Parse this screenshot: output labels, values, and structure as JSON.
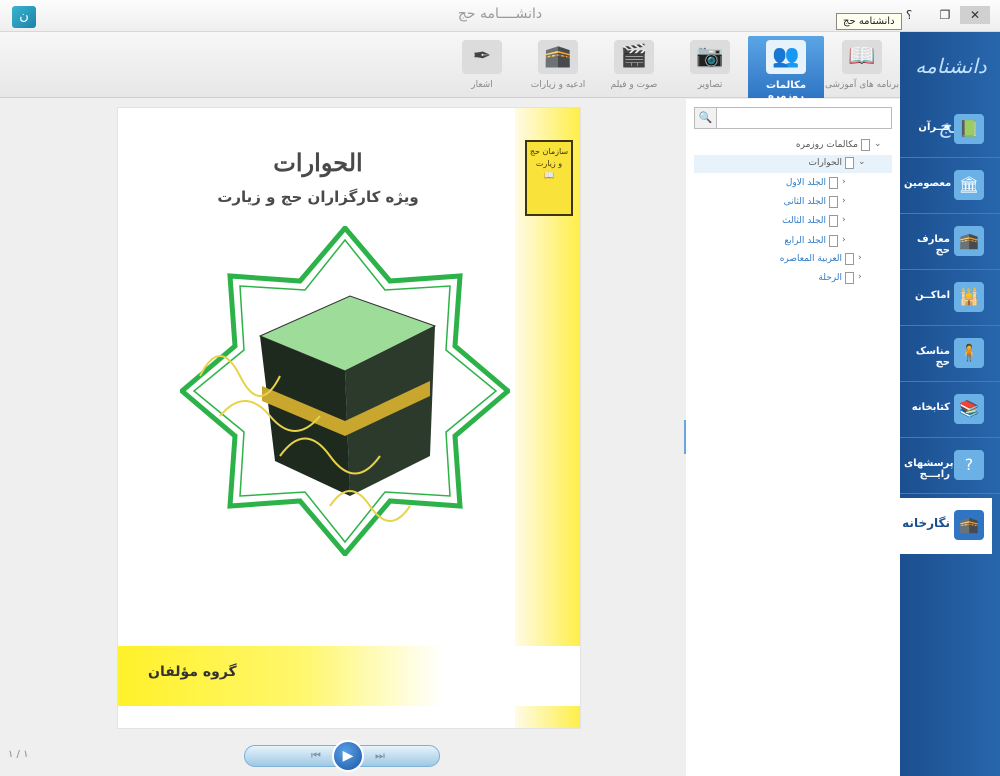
{
  "window": {
    "title": "دانشــــامه حج",
    "tooltip": "دانشنامه حج",
    "help_label": "؟",
    "restore_label": "❐",
    "minimize_label": "—",
    "close_label": "✕",
    "app_icon_label": "ن"
  },
  "toolbar": {
    "tabs": [
      {
        "label": "برنامه های آموزشی",
        "icon": "book-icon"
      },
      {
        "label": "مکالمات روزمره",
        "icon": "people-icon"
      },
      {
        "label": "تصاویر",
        "icon": "camera-icon"
      },
      {
        "label": "صوت و فیلم",
        "icon": "film-icon"
      },
      {
        "label": "ادعیه و زیارات",
        "icon": "prayer-icon"
      },
      {
        "label": "اشعار",
        "icon": "quill-icon"
      }
    ],
    "active_tab": "مکالمات روزمره"
  },
  "sidebar": {
    "logo_text": "دانشنامه حج",
    "items": [
      {
        "label": "قــرآن",
        "icon": "quran-icon"
      },
      {
        "label": "معصومین",
        "icon": "shrine-icon"
      },
      {
        "label": "معارف حج",
        "icon": "kaaba-book-icon"
      },
      {
        "label": "اماکــن",
        "icon": "mosque-icon"
      },
      {
        "label": "مناسک حج",
        "icon": "pilgrim-icon"
      },
      {
        "label": "کتابخانه",
        "icon": "library-icon"
      },
      {
        "label": "پرسشهای رایـــج",
        "icon": "question-icon"
      },
      {
        "label": "نگارخانه",
        "icon": "gallery-icon"
      }
    ],
    "active_item": "نگارخانه"
  },
  "search": {
    "placeholder": "",
    "value": ""
  },
  "tree": [
    {
      "label": "مکالمات روزمره",
      "level": 0,
      "expanded": true
    },
    {
      "label": "الحوارات",
      "level": 1,
      "expanded": true,
      "selected": true
    },
    {
      "label": "الجلد الاول",
      "level": 2
    },
    {
      "label": "الجلد الثانی",
      "level": 2
    },
    {
      "label": "الجلد الثالث",
      "level": 2
    },
    {
      "label": "الجلد الرابع",
      "level": 2
    },
    {
      "label": "العربية المعاصره",
      "level": 1
    },
    {
      "label": "الرحلة",
      "level": 1
    }
  ],
  "viewer": {
    "book_title": "الحوارات",
    "book_subtitle": "ویژه کارگزاران حج و زیارت",
    "authors": "گروه مؤلفان",
    "emblem_text": "سازمان حج و زیارت",
    "page_counter": "۱ / ۱"
  },
  "player": {
    "prev_label": "⏮",
    "play_label": "▶",
    "next_label": "⏭"
  },
  "colors": {
    "sidebar_blue": "#1b4f8f",
    "active_tab_blue": "#2f75c4",
    "cover_yellow": "#ffee44",
    "star_green": "#2db24a"
  }
}
